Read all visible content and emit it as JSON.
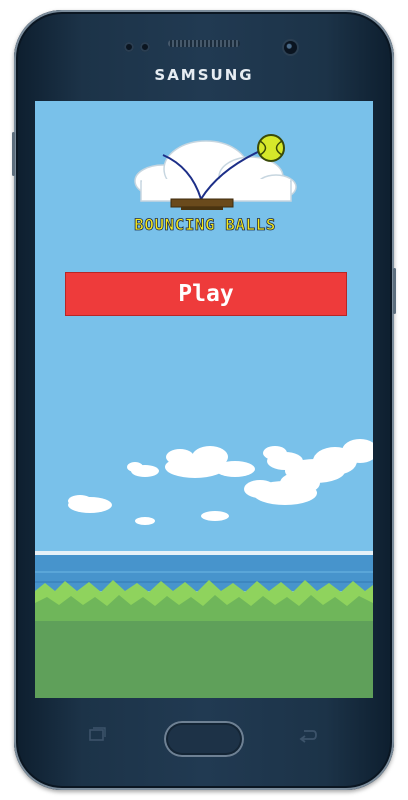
{
  "device": {
    "brand": "SAMSUNG",
    "body_color": "#1c3348"
  },
  "game": {
    "logo_title": "BOUNCING BALLS",
    "play_label": "Play",
    "accent_color": "#ee3b3b",
    "sky_color": "#79c1ea",
    "grass_color": "#5fa05a"
  },
  "nav": {
    "recent_icon": "recent-apps-icon",
    "home_icon": "home-button-icon",
    "back_icon": "back-arrow-icon"
  }
}
